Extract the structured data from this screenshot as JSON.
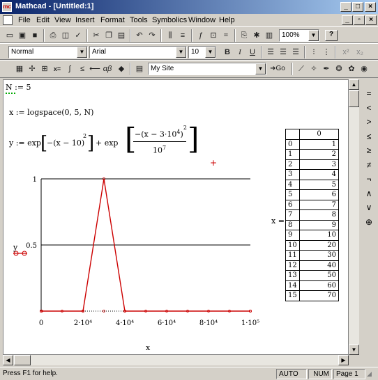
{
  "window": {
    "title": "Mathcad - [Untitled:1]",
    "app_icon_label": "mc",
    "minimize": "_",
    "maximize": "□",
    "close": "×"
  },
  "menu": {
    "items": [
      "File",
      "Edit",
      "View",
      "Insert",
      "Format",
      "Tools",
      "Symbolics",
      "Window",
      "Help"
    ],
    "doc_minimize": "_",
    "doc_restore": "▫",
    "doc_close": "×"
  },
  "toolbar": {
    "zoom": "100%",
    "help_icon": "?"
  },
  "format_bar": {
    "style": "Normal",
    "font": "Arial",
    "size": "10",
    "bold": "B",
    "italic": "I",
    "underline": "U",
    "superscript": "x²",
    "subscript": "x₂"
  },
  "resource_bar": {
    "site": "My Site",
    "go": "Go"
  },
  "worksheet": {
    "def_n": "N := 5",
    "def_x": "x := logspace(0, 5, N)",
    "def_y_prefix": "y := exp",
    "def_y_term1": "−(x − 10)",
    "def_y_exp1": "2",
    "def_y_plus": "+ exp",
    "def_y_num": "−(x − 3·10",
    "def_y_num_exp": "4",
    "def_y_num_close": ")",
    "def_y_num_sq": "2",
    "def_y_den": "10",
    "def_y_den_exp": "7"
  },
  "chart_data": {
    "type": "line",
    "ylabel": "y",
    "xlabel": "x",
    "xlim": [
      0,
      100000
    ],
    "ylim": [
      0,
      1
    ],
    "ytick_labels": [
      "1",
      "0.5"
    ],
    "xtick_labels": [
      "0",
      "2·10⁴",
      "4·10⁴",
      "6·10⁴",
      "8·10⁴",
      "1·10⁵"
    ],
    "grid": "horizontal",
    "series": [
      {
        "x": [
          0,
          200,
          20000,
          30000,
          40000,
          100000
        ],
        "y": [
          0,
          0,
          0,
          1,
          0,
          0
        ],
        "color": "#cc0000"
      }
    ]
  },
  "table": {
    "label": "x =",
    "header": "0",
    "rows": [
      [
        "0",
        "1"
      ],
      [
        "1",
        "2"
      ],
      [
        "2",
        "3"
      ],
      [
        "3",
        "4"
      ],
      [
        "4",
        "5"
      ],
      [
        "5",
        "6"
      ],
      [
        "6",
        "7"
      ],
      [
        "7",
        "8"
      ],
      [
        "8",
        "9"
      ],
      [
        "9",
        "10"
      ],
      [
        "10",
        "20"
      ],
      [
        "11",
        "30"
      ],
      [
        "12",
        "40"
      ],
      [
        "13",
        "50"
      ],
      [
        "14",
        "60"
      ],
      [
        "15",
        "70"
      ]
    ]
  },
  "palette": [
    "=",
    "<",
    ">",
    "≤",
    "≥",
    "≠",
    "¬",
    "∧",
    "∨",
    "⊕"
  ],
  "status": {
    "help": "Press F1 for help.",
    "auto": "AUTO",
    "num": "NUM",
    "page": "Page 1"
  }
}
